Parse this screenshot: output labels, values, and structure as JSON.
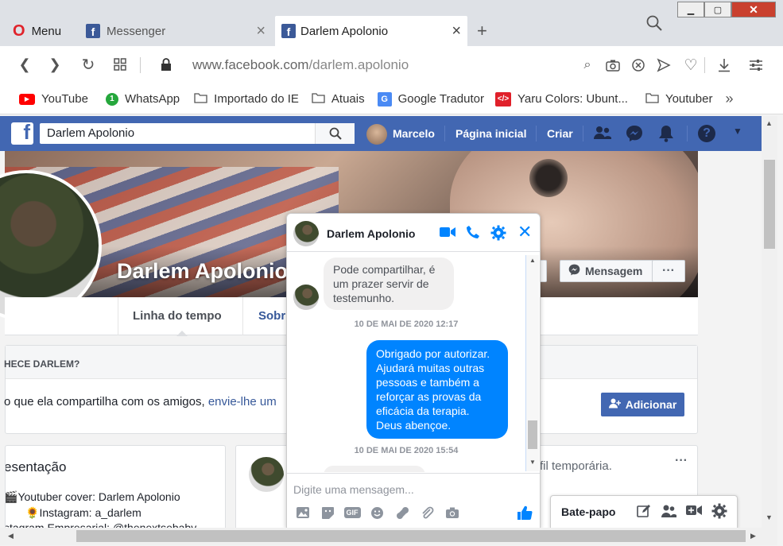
{
  "browser": {
    "tabs": [
      {
        "label": "Menu"
      },
      {
        "label": "Messenger"
      },
      {
        "label": "Darlem Apolonio"
      }
    ],
    "new_tab": "+",
    "url_host": "www.facebook.com",
    "url_path": "/darlem.apolonio",
    "bookmarks": [
      "YouTube",
      "WhatsApp",
      "Importado do IE",
      "Atuais",
      "Google Tradutor",
      "Yaru Colors: Ubunt...",
      "Youtuber"
    ],
    "bookmarks_more": "»"
  },
  "fb": {
    "search_value": "Darlem Apolonio",
    "user": "Marcelo",
    "nav_home": "Página inicial",
    "nav_create": "Criar",
    "profile_name": "Darlem Apolonio",
    "tab_timeline": "Linha do tempo",
    "tab_about": "Sobr",
    "btn_message": "Mensagem",
    "btn_more": "···",
    "know_header": "HECE DARLEM?",
    "know_text": "o que ela compartilha com os amigos,",
    "know_link": "envie-lhe um",
    "btn_add": "Adicionar",
    "intro_title": "esentação",
    "intro_line1": "Youtuber cover: Darlem Apolonio",
    "intro_line2": "Instagram: a_darlem",
    "intro_line3": "stagram Empresarial: @thenextsebaby",
    "temp_text": "fil temporária.",
    "post_more": "···"
  },
  "chat": {
    "name": "Darlem Apolonio",
    "msg_in_1": "Pode compartilhar, é um prazer servir de testemunho.",
    "ts1": "10 DE MAI DE 2020 12:17",
    "msg_out_1": "Obrigado por autorizar. Ajudará muitas outras pessoas e também a reforçar as provas da eficácia da terapia. Deus abençoe.",
    "ts2": "10 DE MAI DE 2020 15:54",
    "input_placeholder": "Digite uma mensagem...",
    "gif_label": "GIF"
  },
  "batepapo": {
    "label": "Bate-papo"
  },
  "colors": {
    "fb_blue": "#4267b2",
    "messenger_blue": "#0084ff"
  }
}
